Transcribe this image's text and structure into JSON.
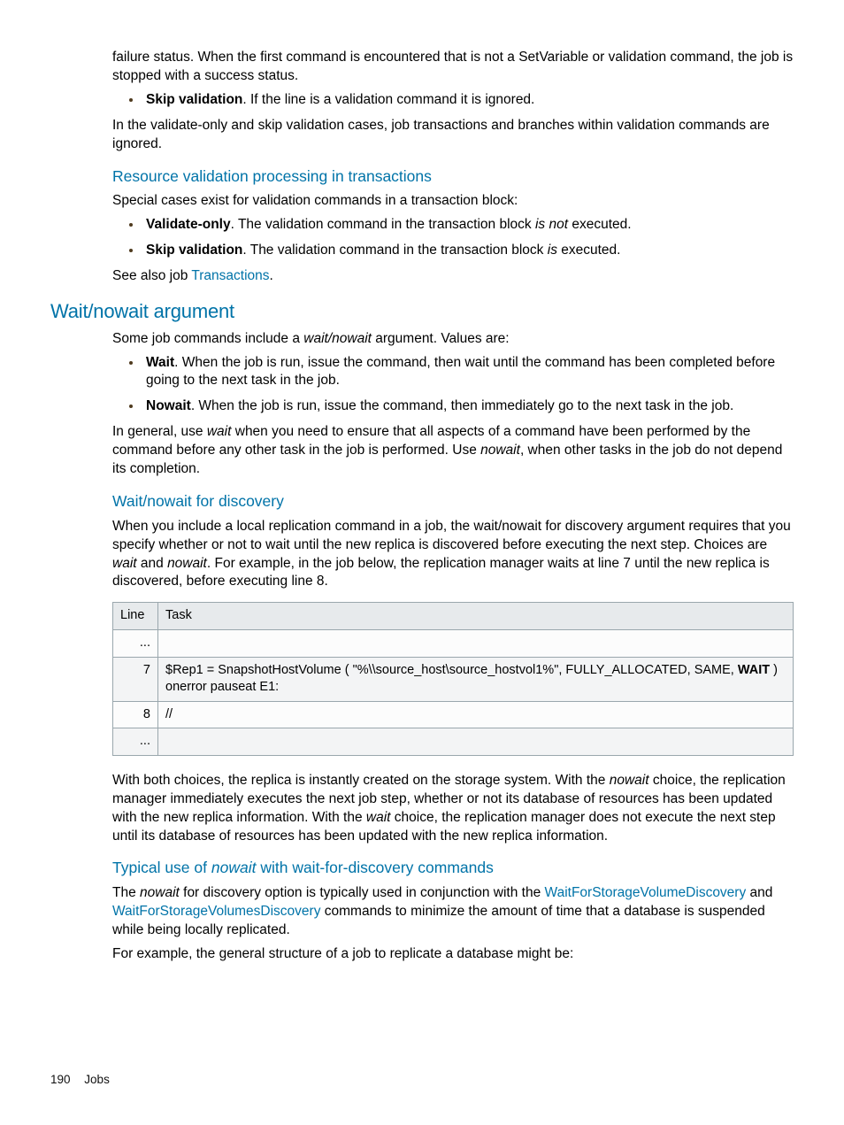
{
  "top_cont_para": "failure status. When the first command is encountered that is not a SetVariable or validation command, the job is stopped with a success status.",
  "skip_bullet": {
    "lead": "Skip validation",
    "rest": ". If the line is a validation command it is ignored."
  },
  "after_skip_para": "In the validate-only and skip validation cases, job transactions and branches within validation commands are ignored.",
  "h_resource": "Resource validation processing in transactions",
  "resource_intro": "Special cases exist for validation commands in a transaction block:",
  "res_b1": {
    "lead": "Validate-only",
    "mid": ". The validation command in the transaction block ",
    "isnot": "is not",
    "tail": " executed."
  },
  "res_b2": {
    "lead": "Skip validation",
    "mid": ". The validation command in the transaction block ",
    "is": "is",
    "tail": " executed."
  },
  "see_also_pre": "See also job ",
  "see_also_link": "Transactions",
  "see_also_post": ".",
  "h_wait": "Wait/nowait argument",
  "wait_intro_pre": "Some job commands include a ",
  "wait_intro_ital": "wait/nowait",
  "wait_intro_post": " argument. Values are:",
  "wait_b1": {
    "lead": "Wait",
    "rest": ". When the job is run, issue the command, then wait until the command has been completed before going to the next task in the job."
  },
  "wait_b2": {
    "lead": "Nowait",
    "rest": ". When the job is run, issue the command, then immediately go to the next task in the job."
  },
  "wait_general": {
    "t1": "In general, use ",
    "i1": "wait",
    "t2": " when you need to ensure that all aspects of a command have been performed by the command before any other task in the job is performed. Use ",
    "i2": "nowait",
    "t3": ", when other tasks in the job do not depend its completion."
  },
  "h_disc": "Wait/nowait for discovery",
  "disc_para": {
    "t1": "When you include a local replication command in a job, the wait/nowait for discovery argument requires that you specify whether or not to wait until the new replica is discovered before executing the next step. Choices are ",
    "i1": "wait",
    "t2": " and ",
    "i2": "nowait",
    "t3": ". For example, in the job below, the replication manager waits at line 7 until the new replica is discovered, before executing line 8."
  },
  "table": {
    "head_line": "Line",
    "head_task": "Task",
    "rows": [
      {
        "line": "...",
        "task": ""
      },
      {
        "line": "7",
        "task_pre": "$Rep1 = SnapshotHostVolume ( \"%\\\\source_host\\source_hostvol1%\", FULLY_ALLOCATED, SAME, ",
        "task_bold": "WAIT",
        "task_post": " ) onerror pauseat E1:"
      },
      {
        "line": "8",
        "task": "//"
      },
      {
        "line": "...",
        "task": ""
      }
    ]
  },
  "after_table": {
    "t1": "With both choices, the replica is instantly created on the storage system. With the ",
    "i1": "nowait",
    "t2": " choice, the replication manager immediately executes the next job step, whether or not its database of resources has been updated with the new replica information. With the ",
    "i2": "wait",
    "t3": " choice, the replication manager does not execute the next step until its database of resources has been updated with the new replica information."
  },
  "h_typical_pre": "Typical use of ",
  "h_typical_ital": "nowait",
  "h_typical_post": " with wait-for-discovery commands",
  "typ_p1": {
    "t1": "The ",
    "i1": "nowait",
    "t2": " for discovery option is typically used in conjunction with the ",
    "l1": "WaitForStorageVolumeDiscovery",
    "t3": " and ",
    "l2": "WaitForStorageVolumesDiscovery",
    "t4": " commands to minimize the amount of time that a database is suspended while being locally replicated."
  },
  "typ_p2": "For example, the general structure of a job to replicate a database might be:",
  "footer_page": "190",
  "footer_sec": "Jobs"
}
